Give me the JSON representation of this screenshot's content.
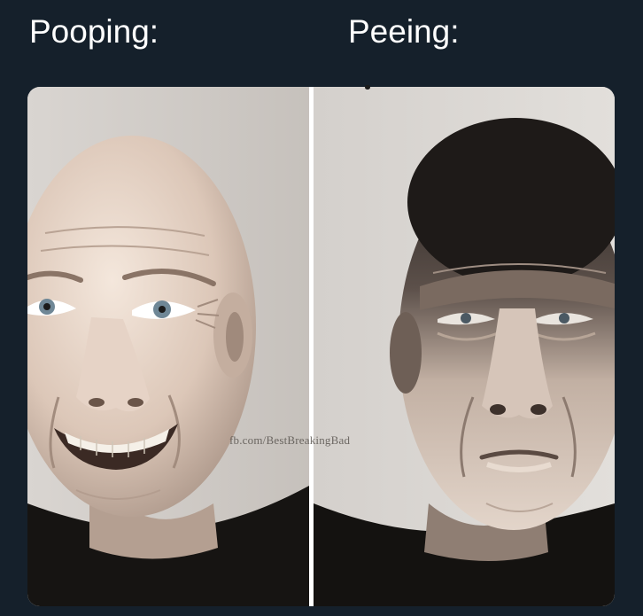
{
  "captions": {
    "left": "Pooping:",
    "right": "Peeing:"
  },
  "watermark": "fb.com/BestBreakingBad",
  "colors": {
    "background": "#15202b",
    "caption_text": "#ffffff",
    "photo_backdrop": "#cfcbc6"
  }
}
